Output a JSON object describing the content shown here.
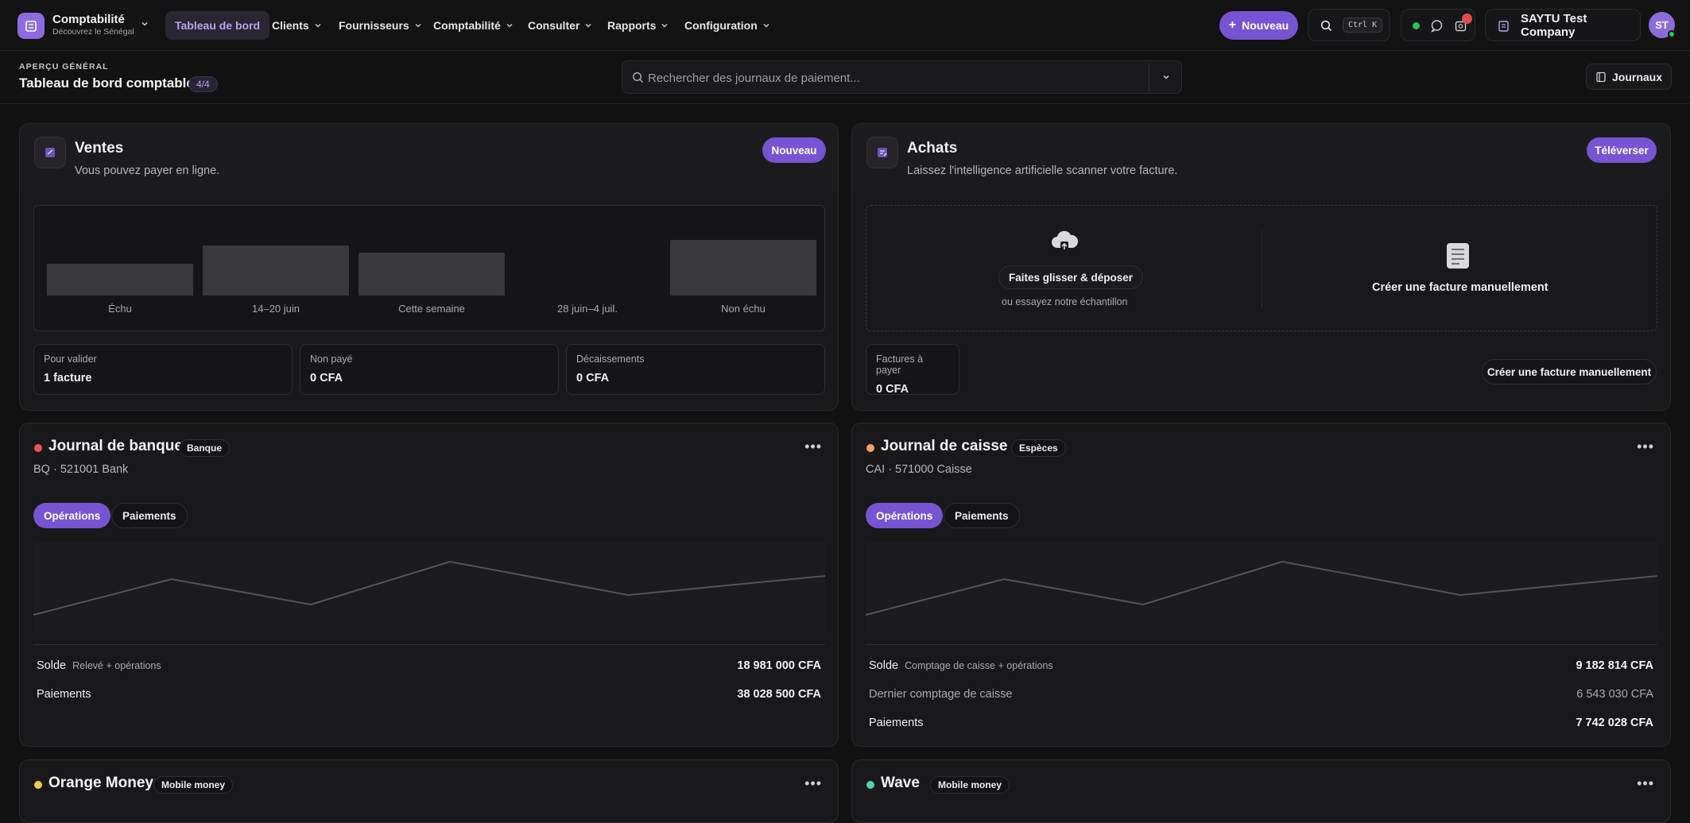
{
  "app": {
    "name": "Comptabilité",
    "subtitle": "Découvrez le Sénégal"
  },
  "nav": {
    "items": [
      {
        "label": "Tableau de bord"
      },
      {
        "label": "Clients"
      },
      {
        "label": "Fournisseurs"
      },
      {
        "label": "Comptabilité"
      },
      {
        "label": "Consulter"
      },
      {
        "label": "Rapports"
      },
      {
        "label": "Configuration"
      }
    ]
  },
  "toolbar": {
    "new_label": "Nouveau",
    "shortcut": "Ctrl K",
    "company": "SAYTU Test Company",
    "avatar": "ST"
  },
  "header": {
    "eyebrow": "APERÇU GÉNÉRAL",
    "title": "Tableau de bord comptable",
    "counter": "4/4",
    "search_placeholder": "Rechercher des journaux de paiement...",
    "journaux_label": "Journaux"
  },
  "sales": {
    "title": "Ventes",
    "subtitle": "Vous pouvez payer en ligne.",
    "button": "Nouveau",
    "chart_data": {
      "type": "bar",
      "categories": [
        "Échu",
        "14–20 juin",
        "Cette semaine",
        "28 juin–4 juil.",
        "Non échu"
      ],
      "values": [
        0.57,
        0.9,
        0.77,
        0,
        1.0
      ]
    },
    "stats": [
      {
        "label": "Pour valider",
        "value": "1 facture"
      },
      {
        "label": "Non payé",
        "value": "0 CFA"
      },
      {
        "label": "Décaissements",
        "value": "0 CFA"
      }
    ]
  },
  "purchases": {
    "title": "Achats",
    "subtitle": "Laissez l'intelligence artificielle scanner votre facture.",
    "button": "Téléverser",
    "drop_label": "Faites glisser & déposer",
    "drop_hint": "ou essayez notre échantillon",
    "manual_label": "Créer une facture manuellement",
    "stat": {
      "label": "Factures à payer",
      "value": "0 CFA"
    },
    "manual_button": "Créer une facture manuellement"
  },
  "bank": {
    "title": "Journal de banque",
    "badge": "Banque",
    "code": "BQ · 521001 Bank",
    "dot_color": "#ef5350",
    "tabs": [
      "Opérations",
      "Paiements"
    ],
    "rows": [
      {
        "key": "Solde",
        "note": "Relevé + opérations",
        "value": "18 981 000 CFA"
      },
      {
        "key": "Paiements",
        "note": "",
        "value": "38 028 500 CFA"
      }
    ]
  },
  "cash": {
    "title": "Journal de caisse",
    "badge": "Espèces",
    "code": "CAI · 571000 Caisse",
    "dot_color": "#f4a261",
    "tabs": [
      "Opérations",
      "Paiements"
    ],
    "rows": [
      {
        "key": "Solde",
        "note": "Comptage de caisse + opérations",
        "value": "9 182 814 CFA"
      },
      {
        "key": "Dernier comptage de caisse",
        "note": "",
        "value": "6 543 030 CFA"
      },
      {
        "key": "Paiements",
        "note": "",
        "value": "7 742 028 CFA"
      }
    ]
  },
  "orange": {
    "title": "Orange Money",
    "badge": "Mobile money",
    "dot_color": "#f2c94c"
  },
  "wave": {
    "title": "Wave",
    "badge": "Mobile money",
    "dot_color": "#4fd1b0"
  },
  "colors": {
    "accent": "#7654d2",
    "background": "#121213",
    "card": "#19191b"
  }
}
